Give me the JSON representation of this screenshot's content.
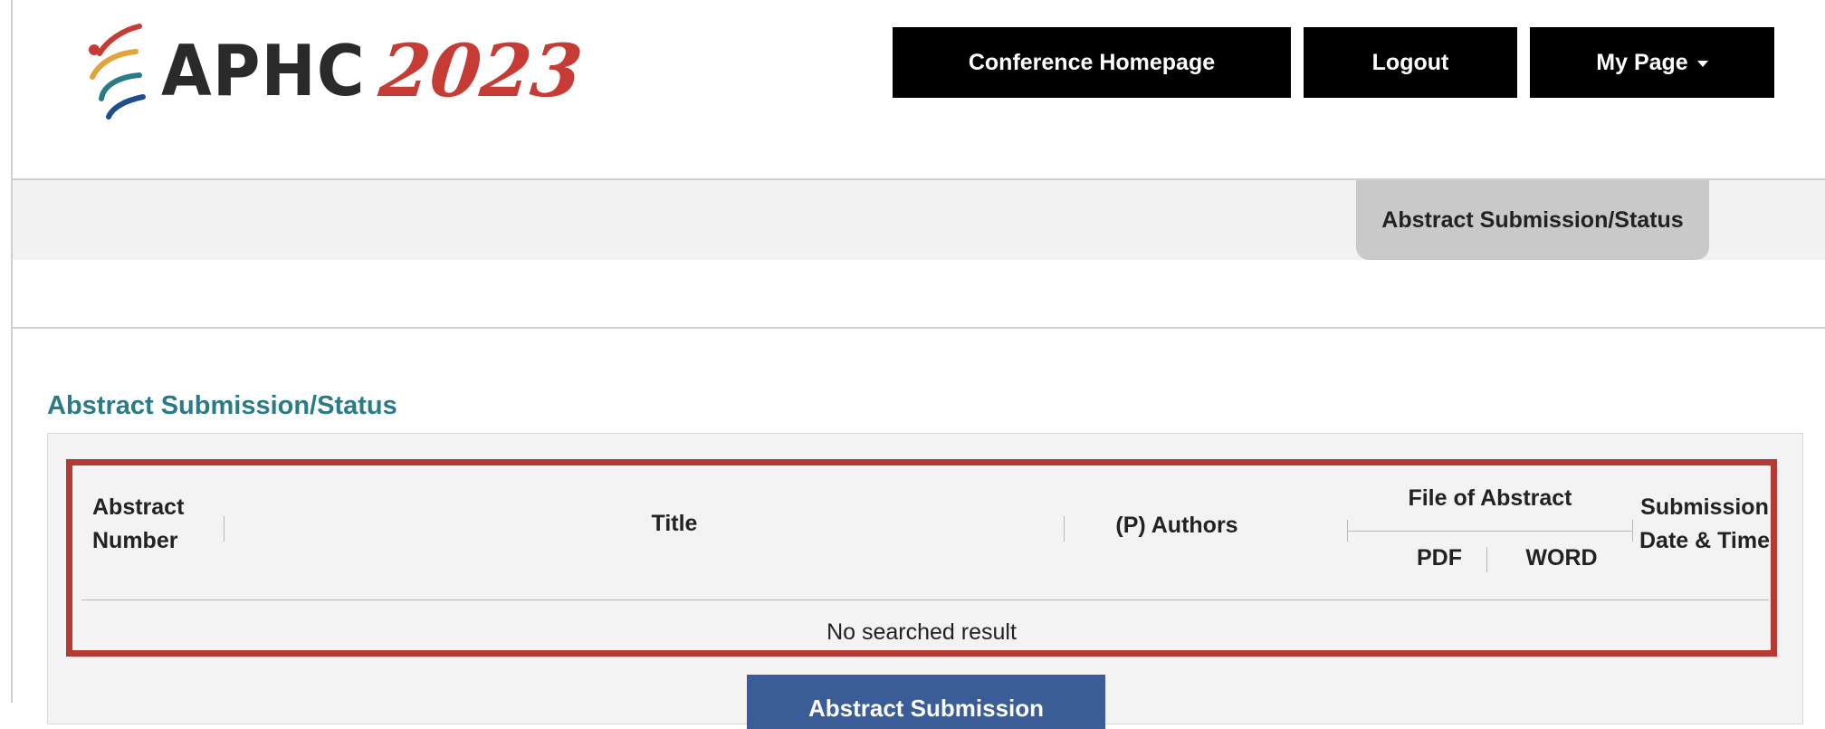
{
  "header": {
    "logo_text": "APHC",
    "logo_year": "2023",
    "nav": {
      "conference_homepage": "Conference Homepage",
      "logout": "Logout",
      "my_page": "My Page"
    }
  },
  "subnav": {
    "active_tab": "Abstract Submission/Status"
  },
  "main": {
    "section_title": "Abstract Submission/Status",
    "table": {
      "headers": {
        "abstract_number_line1": "Abstract",
        "abstract_number_line2": "Number",
        "title": "Title",
        "authors": "(P) Authors",
        "file_of_abstract": "File of Abstract",
        "pdf": "PDF",
        "word": "WORD",
        "submission_line1": "Submission",
        "submission_line2": "Date & Time"
      },
      "empty_message": "No searched result"
    },
    "submit_button": "Abstract Submission"
  },
  "colors": {
    "accent_orange": "#e2a33b",
    "highlight_red": "#b53a33",
    "section_title_teal": "#2a7a8a",
    "button_blue": "#3b5d97",
    "logo_red": "#c63b33"
  }
}
